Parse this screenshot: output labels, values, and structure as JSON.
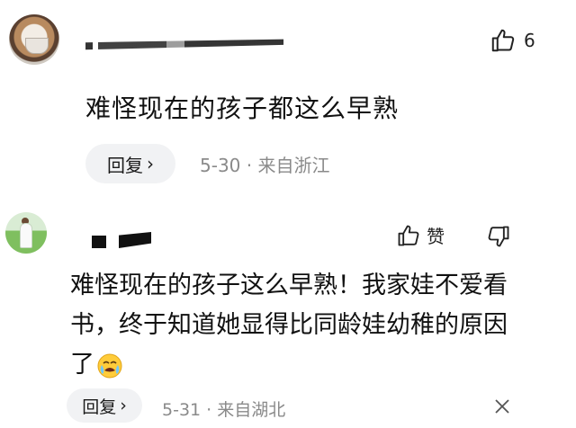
{
  "comments": [
    {
      "like_count": "6",
      "text": "难怪现在的孩子都这么早熟",
      "reply_label": "回复",
      "date": "5-30",
      "separator": "·",
      "location": "来自浙江"
    },
    {
      "like_label": "赞",
      "text_line1": "难怪现在的孩子这么早熟！我家娃不爱看",
      "text_line2": "书，终于知道她显得比同龄娃幼稚的原因",
      "text_line3": "了",
      "emoji_icon": "crying-face-icon",
      "reply_label": "回复",
      "date": "5-31",
      "separator": "·",
      "location": "来自湖北"
    }
  ],
  "colors": {
    "meta_text": "#8a8a8a",
    "reply_bg": "#f1f2f4",
    "body_text": "#111111"
  }
}
